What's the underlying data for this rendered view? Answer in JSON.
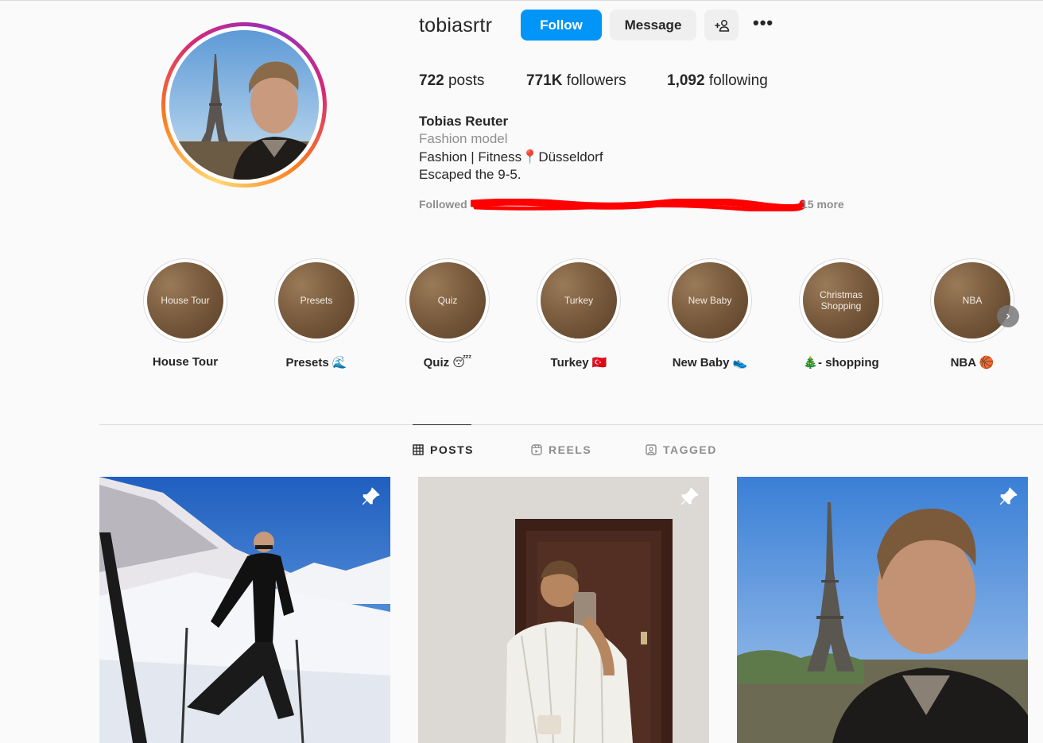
{
  "profile": {
    "username": "tobiasrtr",
    "follow_label": "Follow",
    "message_label": "Message",
    "add_user_glyph": "+♙",
    "more_glyph": "•••"
  },
  "stats": {
    "posts_count": "722",
    "posts_label": "posts",
    "followers_count": "771K",
    "followers_label": "followers",
    "following_count": "1,092",
    "following_label": "following"
  },
  "bio": {
    "name": "Tobias Reuter",
    "category": "Fashion model",
    "line1_pre": "Fashion | Fitness",
    "line1_emoji": "📍",
    "line1_post": "Düsseldorf",
    "line2": "Escaped the 9-5.",
    "followed_by_prefix": "Followed",
    "followed_by_more": "15 more"
  },
  "highlights": [
    {
      "cover_text": "House Tour",
      "label": "House Tour"
    },
    {
      "cover_text": "Presets",
      "label": "Presets 🌊"
    },
    {
      "cover_text": "Quiz",
      "label": "Quiz 😴"
    },
    {
      "cover_text": "Turkey",
      "label": "Turkey 🇹🇷"
    },
    {
      "cover_text": "New Baby",
      "label": "New Baby 👟"
    },
    {
      "cover_text": "Christmas Shopping",
      "label": "🎄- shopping"
    },
    {
      "cover_text": "NBA",
      "label": "NBA 🏀"
    }
  ],
  "highlights_next_glyph": "›",
  "tabs": {
    "posts": "POSTS",
    "reels": "REELS",
    "tagged": "TAGGED"
  },
  "icons": {
    "follow": "add-user-icon",
    "more": "more-options-icon",
    "pin": "pin-icon",
    "grid": "grid-icon",
    "reels": "reels-icon",
    "tagged": "tagged-icon"
  },
  "colors": {
    "accent": "#0095f6",
    "text": "#262626",
    "muted": "#8e8e8e",
    "redaction": "#ff0000"
  }
}
